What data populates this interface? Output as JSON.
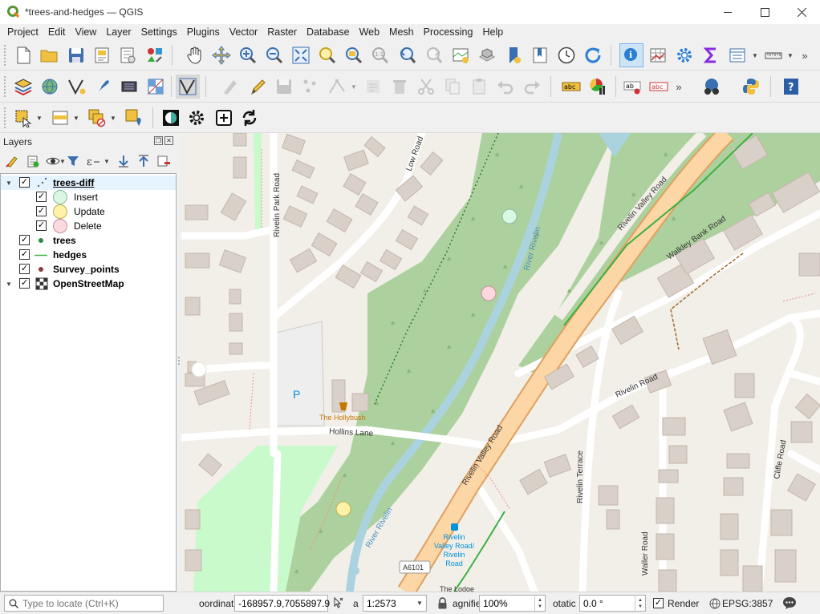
{
  "window": {
    "title": "*trees-and-hedges — QGIS",
    "minimize_glyph": "—",
    "maximize_glyph": "☐",
    "close_glyph": "✕"
  },
  "menu": [
    "Project",
    "Edit",
    "View",
    "Layer",
    "Settings",
    "Plugins",
    "Vector",
    "Raster",
    "Database",
    "Web",
    "Mesh",
    "Processing",
    "Help"
  ],
  "layers_panel": {
    "title": "Layers",
    "layers": [
      {
        "name": "trees-diff",
        "checked": true,
        "expanded": true,
        "selected": true,
        "icon": "point-cluster-icon",
        "classes": [
          {
            "label": "Insert",
            "color": "#d9f7e3",
            "stroke": "#8ab89a"
          },
          {
            "label": "Update",
            "color": "#fdf2a8",
            "stroke": "#c2ad55"
          },
          {
            "label": "Delete",
            "color": "#fcd9de",
            "stroke": "#c4919a"
          }
        ]
      },
      {
        "name": "trees",
        "checked": true,
        "icon": "green-point-icon",
        "color": "#2b8a3e"
      },
      {
        "name": "hedges",
        "checked": true,
        "icon": "green-line-icon",
        "color": "#3cb043"
      },
      {
        "name": "Survey_points",
        "checked": true,
        "icon": "brown-point-icon",
        "color": "#8b3a3a"
      },
      {
        "name": "OpenStreetMap",
        "checked": true,
        "expanded": true,
        "icon": "raster-tile-icon"
      }
    ]
  },
  "map": {
    "streets": [
      "Low Road",
      "Rivelin Park Road",
      "Rivelin Valley Road",
      "Walkley Bank Road",
      "River Rivelin",
      "Rivelin Road",
      "Hollins Lane",
      "Rivelin Terrace",
      "Waller Road",
      "Cliffe Road"
    ],
    "poi_parking": "P",
    "poi_pub": "The Hollybush",
    "bus_stop": "Rivelin Valley Road/ Rivelin Road",
    "bus_stop_lines": [
      "Rivelin",
      "Valley Road/",
      "Rivelin",
      "Road"
    ],
    "road_ref": "A6101",
    "lodge": "The Lodge"
  },
  "statusbar": {
    "locate_placeholder": "Type to locate (Ctrl+K)",
    "coordinate_label": "oordinat",
    "coordinate_value": "-168957.9,7055897.9",
    "scale_label": "a",
    "scale_value": "1:2573",
    "magnifier_label": "agnifie",
    "magnifier_value": "100%",
    "rotation_label": "otatic",
    "rotation_value": "0.0 °",
    "render_label": "Render",
    "render_checked": true,
    "crs": "EPSG:3857"
  },
  "colors": {
    "wood": "#add19e",
    "park": "#c8facc",
    "water": "#aad3df",
    "primary_road": "#fcd6a4",
    "primary_casing": "#e0a060",
    "building": "#d9d0c9",
    "building_stroke": "#c4b6ab",
    "hedge": "#3cb043"
  }
}
